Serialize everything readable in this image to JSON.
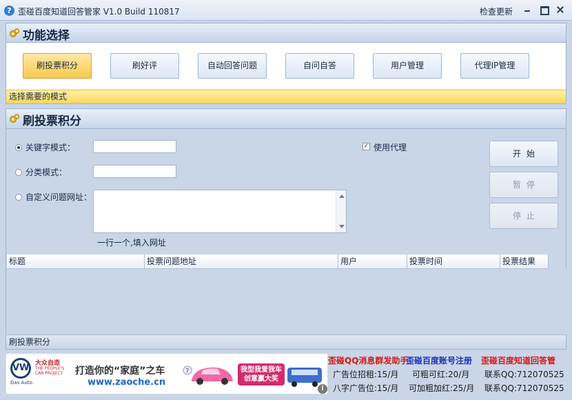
{
  "window": {
    "title": "歪碰百度知道回答管家 V1.0 Build 110817",
    "check_update": "检查更新"
  },
  "func_panel": {
    "title": "功能选择",
    "buttons": [
      {
        "label": "刷投票积分",
        "active": true
      },
      {
        "label": "刷好评"
      },
      {
        "label": "自动回答问题"
      },
      {
        "label": "自问自答"
      },
      {
        "label": "用户管理"
      },
      {
        "label": "代理IP管理"
      }
    ],
    "hint": "选择需要的模式"
  },
  "main_panel": {
    "title": "刷投票积分",
    "keyword_label": "关键字模式：",
    "keyword_value": "",
    "category_label": "分类模式：",
    "category_value": "",
    "custom_url_label": "自定义问题网址：",
    "custom_url_hint": "一行一个,填入网址",
    "use_proxy_label": "使用代理",
    "start_label": "开始",
    "pause_label": "暂停",
    "stop_label": "停止",
    "columns": [
      "标题",
      "投票问题地址",
      "用户",
      "投票时间",
      "投票结果"
    ],
    "status": "刷投票积分"
  },
  "banner": {
    "logo_text": "VW",
    "logo_sub": "Das Auto.",
    "brand": "大众自造",
    "brand_en": "THE PEOPLE'S CAR PROJECT",
    "slogan": "打造你的“家庭”之车",
    "url": "www.zaoche.cn",
    "badge": "我型我爱我车创意赢大奖",
    "info": "i"
  },
  "ads": {
    "link1": "歪碰QQ消息群发助手",
    "link2": "歪碰百度账号注册",
    "link3": "歪碰百度知道回答管",
    "row2_a": "广告位招租:15/月",
    "row2_b": "可粗可红:20/月",
    "row2_c": "联系QQ:712070525",
    "row3_a": "八字广告位:15/月",
    "row3_b": "可加粗加红:25/月",
    "row3_c": "联系QQ:712070525"
  }
}
